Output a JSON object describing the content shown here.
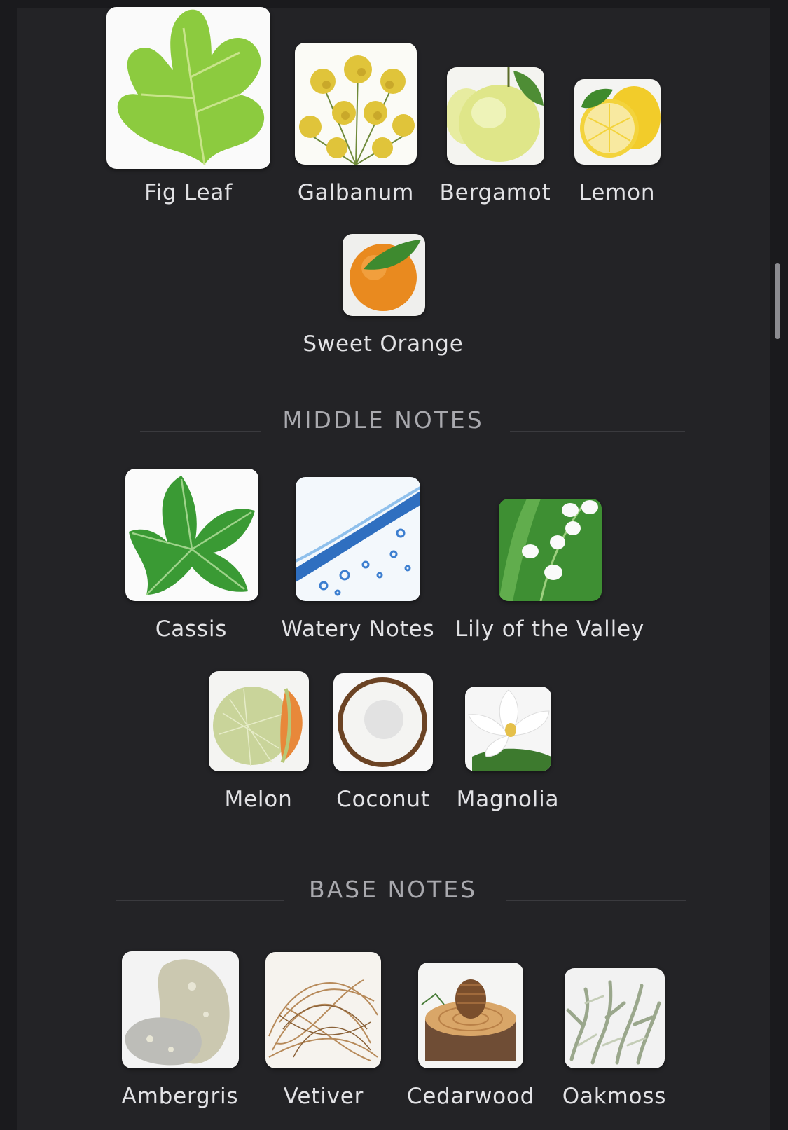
{
  "top_notes": [
    {
      "label": "Fig Leaf",
      "icon": "fig-leaf-icon"
    },
    {
      "label": "Galbanum",
      "icon": "galbanum-icon"
    },
    {
      "label": "Bergamot",
      "icon": "bergamot-icon"
    },
    {
      "label": "Lemon",
      "icon": "lemon-icon"
    },
    {
      "label": "Sweet Orange",
      "icon": "sweet-orange-icon"
    }
  ],
  "middle_notes": {
    "heading": "MIDDLE NOTES",
    "items": [
      {
        "label": "Cassis",
        "icon": "cassis-icon"
      },
      {
        "label": "Watery Notes",
        "icon": "watery-notes-icon"
      },
      {
        "label": "Lily of the Valley",
        "icon": "lily-of-the-valley-icon"
      },
      {
        "label": "Melon",
        "icon": "melon-icon"
      },
      {
        "label": "Coconut",
        "icon": "coconut-icon"
      },
      {
        "label": "Magnolia",
        "icon": "magnolia-icon"
      }
    ]
  },
  "base_notes": {
    "heading": "BASE NOTES",
    "items": [
      {
        "label": "Ambergris",
        "icon": "ambergris-icon"
      },
      {
        "label": "Vetiver",
        "icon": "vetiver-icon"
      },
      {
        "label": "Cedarwood",
        "icon": "cedarwood-icon"
      },
      {
        "label": "Oakmoss",
        "icon": "oakmoss-icon"
      }
    ]
  },
  "colors": {
    "background": "#1a1a1d",
    "panel": "#232326",
    "text": "#e2e2e5",
    "heading": "#a9a9ae"
  }
}
